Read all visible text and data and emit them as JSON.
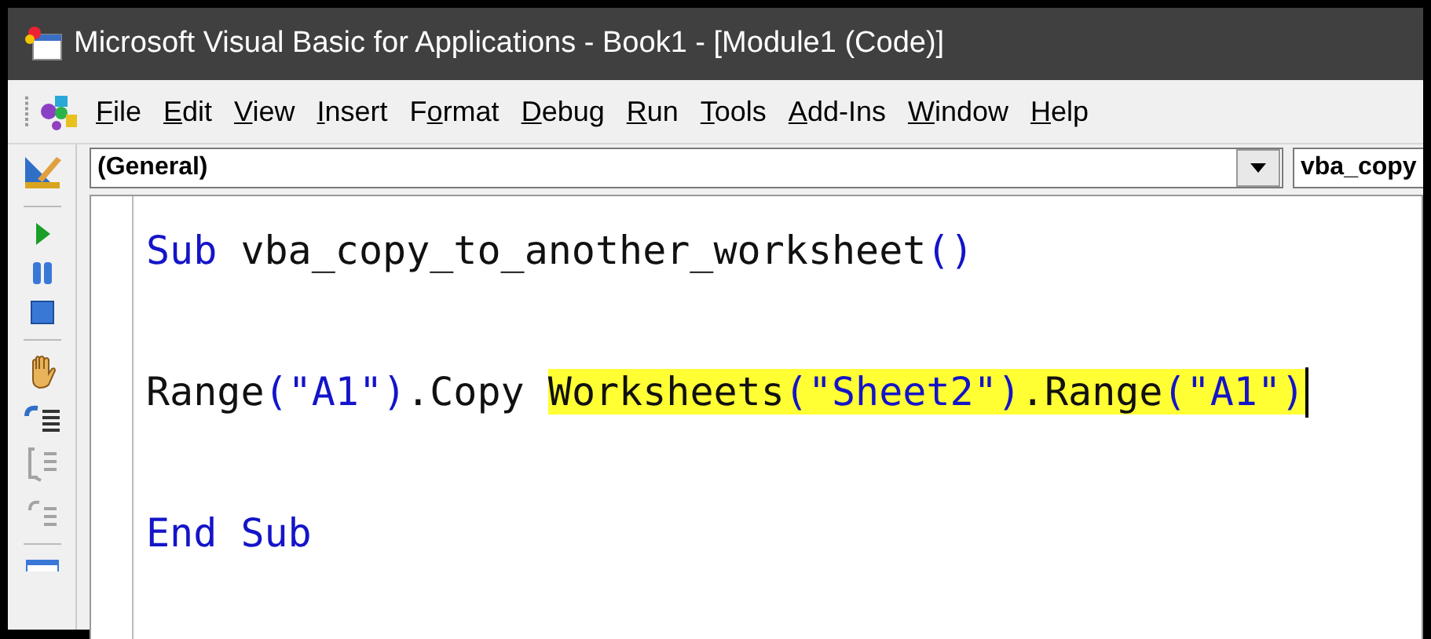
{
  "window": {
    "title": "Microsoft Visual Basic for Applications - Book1 - [Module1 (Code)]"
  },
  "menu": [
    {
      "key": "F",
      "after": "ile"
    },
    {
      "key": "E",
      "after": "dit"
    },
    {
      "key": "V",
      "after": "iew"
    },
    {
      "key": "I",
      "after": "nsert"
    },
    {
      "before": "F",
      "key": "o",
      "after": "rmat"
    },
    {
      "key": "D",
      "after": "ebug"
    },
    {
      "key": "R",
      "after": "un"
    },
    {
      "key": "T",
      "after": "ools"
    },
    {
      "key": "A",
      "after": "dd-Ins"
    },
    {
      "key": "W",
      "after": "indow"
    },
    {
      "key": "H",
      "after": "elp"
    }
  ],
  "toolbar": [
    {
      "kind": "design",
      "disabled": false
    },
    {
      "kind": "sep"
    },
    {
      "kind": "run",
      "disabled": false
    },
    {
      "kind": "pause",
      "disabled": false
    },
    {
      "kind": "stop",
      "disabled": false
    },
    {
      "kind": "sep"
    },
    {
      "kind": "hand",
      "disabled": false
    },
    {
      "kind": "indent",
      "disabled": false
    },
    {
      "kind": "comment",
      "disabled": true
    },
    {
      "kind": "uncomment",
      "disabled": true
    },
    {
      "kind": "sep"
    },
    {
      "kind": "window",
      "disabled": false
    }
  ],
  "object_box": {
    "value": "(General)"
  },
  "procedure_box": {
    "value": "vba_copy"
  },
  "code": [
    {
      "tokens": [
        {
          "kind": "keyword",
          "text": "Sub",
          "highlighted": false
        },
        {
          "kind": "plain",
          "text": " vba_copy_to_another_worksheet",
          "highlighted": false
        },
        {
          "kind": "keyword",
          "text": "()",
          "highlighted": false
        }
      ]
    },
    {
      "tokens": [
        {
          "kind": "plain",
          "text": "Range",
          "highlighted": false
        },
        {
          "kind": "keyword",
          "text": "(\"A1\")",
          "highlighted": false
        },
        {
          "kind": "plain",
          "text": ".Copy ",
          "highlighted": false
        },
        {
          "kind": "plain",
          "text": "Worksheets",
          "highlighted": true
        },
        {
          "kind": "keyword",
          "text": "(\"Sheet2\")",
          "highlighted": true
        },
        {
          "kind": "plain",
          "text": ".Range",
          "highlighted": true
        },
        {
          "kind": "keyword",
          "text": "(\"A1\")",
          "highlighted": true
        }
      ],
      "cursor": true
    },
    {
      "tokens": [
        {
          "kind": "keyword",
          "text": "End Sub",
          "highlighted": false
        }
      ]
    }
  ]
}
